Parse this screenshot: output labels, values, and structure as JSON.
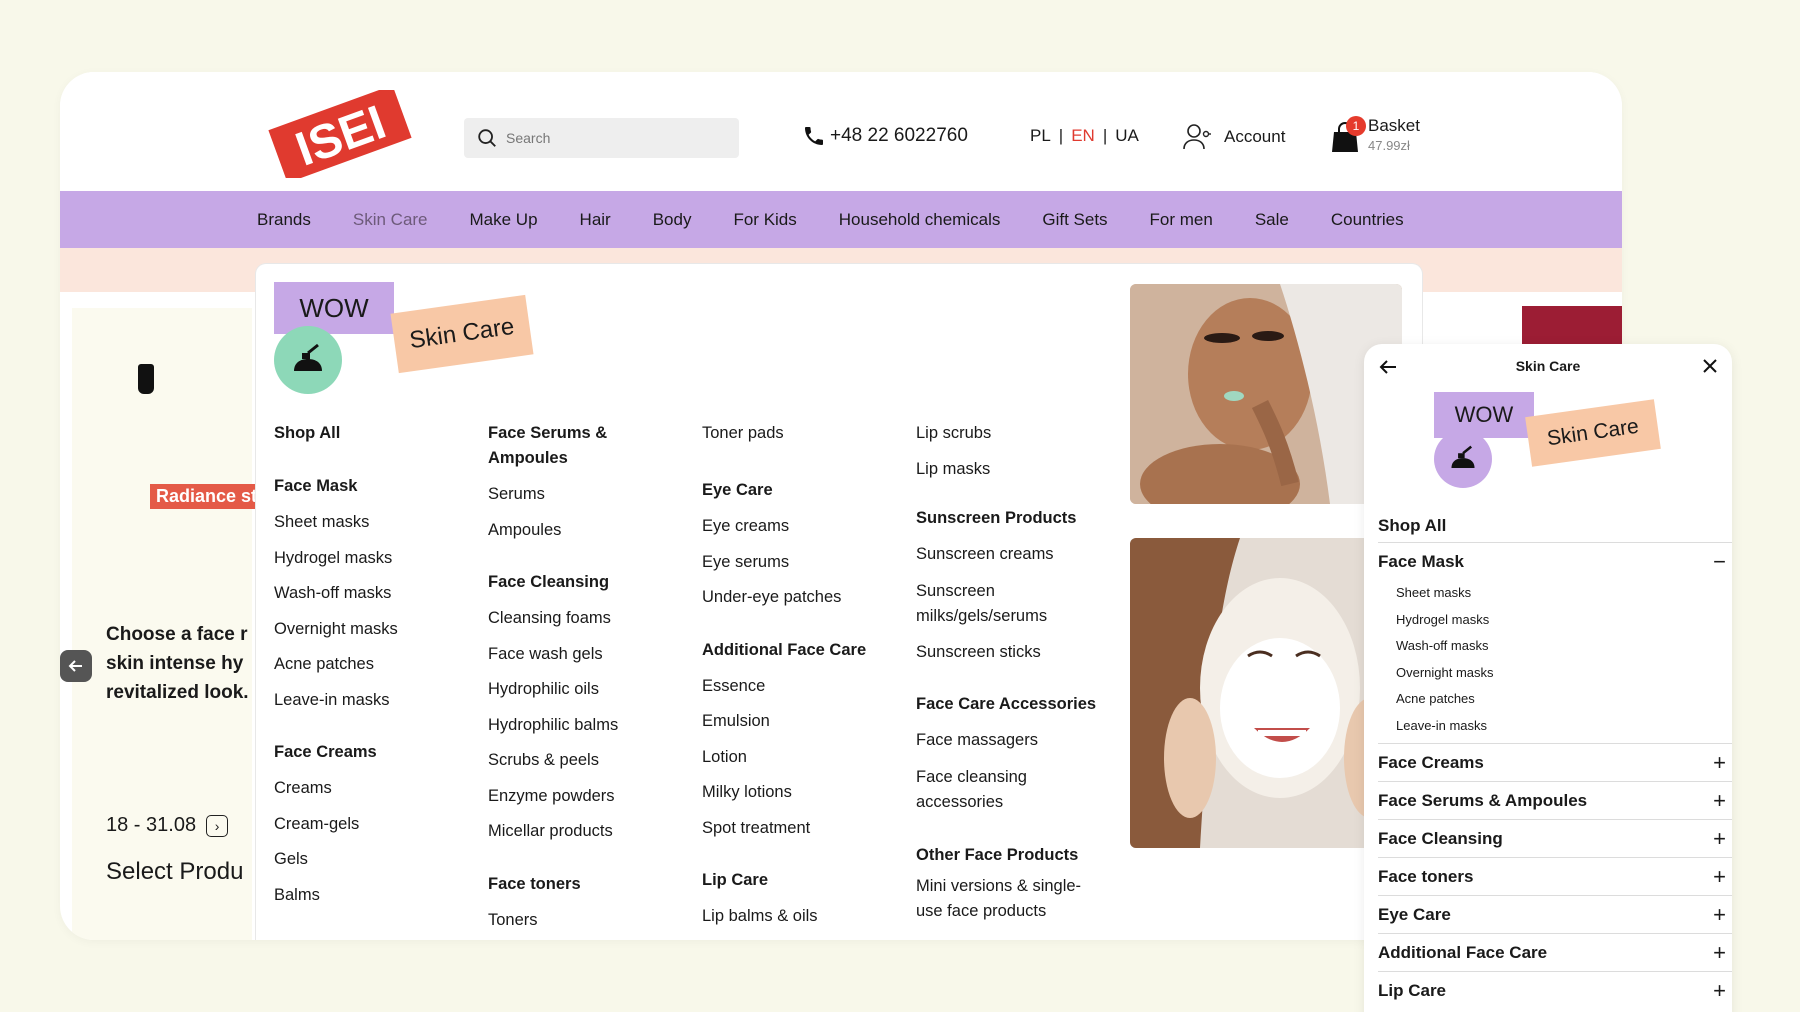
{
  "header": {
    "logo_text": "ISEI",
    "search_placeholder": "Search",
    "phone": "+48 22 6022760",
    "languages": [
      "PL",
      "EN",
      "UA"
    ],
    "language_active": "EN",
    "account_label": "Account",
    "basket_label": "Basket",
    "basket_amount": "47.99zł",
    "basket_count": "1"
  },
  "nav": {
    "items": [
      "Brands",
      "Skin Care",
      "Make Up",
      "Hair",
      "Body",
      "For Kids",
      "Household chemicals",
      "Gift Sets",
      "For men",
      "Sale",
      "Countries"
    ],
    "current": "Skin Care"
  },
  "left_content": {
    "badge": "Radiance st",
    "text_lines": [
      "Choose a face r",
      "skin intense hy",
      "revitalized look."
    ],
    "dates": "18 - 31.08",
    "select": "Select Produ"
  },
  "mega": {
    "wow": "WOW",
    "tag": "Skin Care",
    "col1": {
      "shop_all": "Shop All",
      "face_mask": "Face Mask",
      "face_mask_items": [
        "Sheet masks",
        "Hydrogel masks",
        "Wash-off masks",
        "Overnight masks",
        "Acne patches",
        "Leave-in masks"
      ],
      "face_creams": "Face Creams",
      "face_creams_items": [
        "Creams",
        "Cream-gels",
        "Gels",
        "Balms"
      ]
    },
    "col2": {
      "serums": "Face Serums & Ampoules",
      "serums_items": [
        "Serums",
        "Ampoules"
      ],
      "cleansing": "Face Cleansing",
      "cleansing_items": [
        "Cleansing foams",
        "Face wash gels",
        "Hydrophilic oils",
        "Hydrophilic balms",
        "Scrubs & peels",
        "Enzyme powders",
        "Micellar products"
      ],
      "toners": "Face toners",
      "toners_items": [
        "Toners"
      ]
    },
    "col3": {
      "top_items": [
        "Toner pads"
      ],
      "eye": "Eye Care",
      "eye_items": [
        "Eye creams",
        "Eye serums",
        "Under-eye patches"
      ],
      "additional": "Additional Face Care",
      "additional_items": [
        "Essence",
        "Emulsion",
        "Lotion",
        "Milky lotions",
        "Spot treatment"
      ],
      "lip": "Lip Care",
      "lip_items": [
        "Lip balms & oils"
      ]
    },
    "col4": {
      "top_items": [
        "Lip scrubs",
        "Lip masks"
      ],
      "sunscreen": "Sunscreen Products",
      "sunscreen_items": [
        "Sunscreen creams",
        "Sunscreen milks/gels/serums",
        "Sunscreen sticks"
      ],
      "accessories": "Face Care Accessories",
      "accessories_items": [
        "Face massagers",
        "Face cleansing accessories"
      ],
      "other": "Other Face Products",
      "other_items": [
        "Mini versions & single-use face products"
      ]
    }
  },
  "mobile": {
    "title": "Skin Care",
    "wow": "WOW",
    "tag": "Skin Care",
    "shop_all": "Shop All",
    "expanded": "Face Mask",
    "expanded_items": [
      "Sheet masks",
      "Hydrogel masks",
      "Wash-off masks",
      "Overnight masks",
      "Acne patches",
      "Leave-in masks"
    ],
    "collapsed": [
      "Face Creams",
      "Face Serums & Ampoules",
      "Face Cleansing",
      "Face toners",
      "Eye Care",
      "Additional Face Care",
      "Lip Care"
    ]
  },
  "colors": {
    "nav_bg": "#c6a8e6",
    "logo_red": "#e03a2f",
    "tag_peach": "#f8c8a6",
    "mint": "#8dd8b8"
  }
}
